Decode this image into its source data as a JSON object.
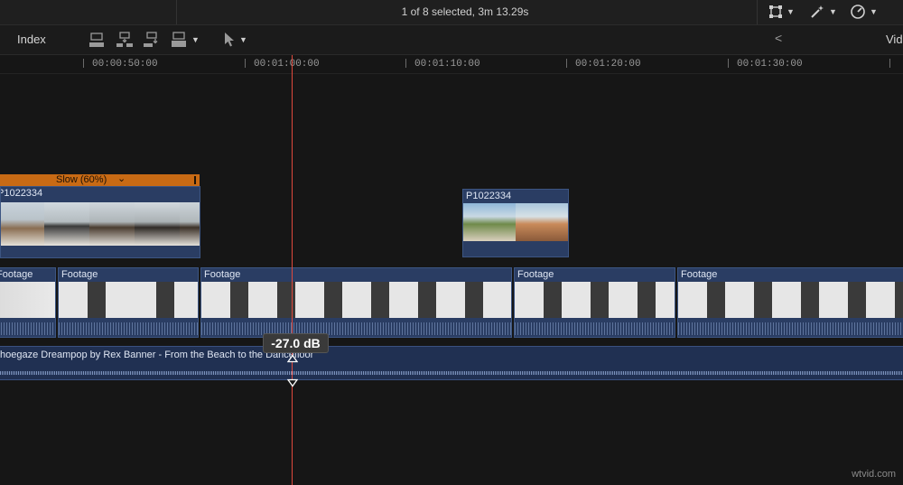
{
  "topbar": {
    "selection_status": "1 of 8 selected, 3m 13.29s",
    "icons": [
      "transform-icon",
      "magic-wand-icon",
      "speed-gauge-icon"
    ]
  },
  "toolbar": {
    "index_label": "Index",
    "vid_label": "Vid",
    "tools": [
      "connect-clip-icon",
      "insert-clip-icon",
      "append-clip-icon",
      "overwrite-clip-icon",
      "select-arrow-tool-icon"
    ]
  },
  "ruler": {
    "labels": [
      "00:00:50:00",
      "00:01:00:00",
      "00:01:10:00",
      "00:01:20:00",
      "00:01:30:00"
    ]
  },
  "retime": {
    "label": "Slow (60%)",
    "chevron": "⌄"
  },
  "connected_clips": [
    {
      "name": "P1022334"
    },
    {
      "name": "P1022334"
    }
  ],
  "primary_clips": [
    {
      "name": "Footage"
    },
    {
      "name": "Footage"
    },
    {
      "name": "Footage"
    },
    {
      "name": "Footage"
    },
    {
      "name": "Footage"
    }
  ],
  "music": {
    "title": "hoegaze Dreampop by Rex Banner - From the Beach to the Dancefloor"
  },
  "volume": {
    "db_value": "-27.0 dB"
  },
  "watermark": "wtvid.com"
}
